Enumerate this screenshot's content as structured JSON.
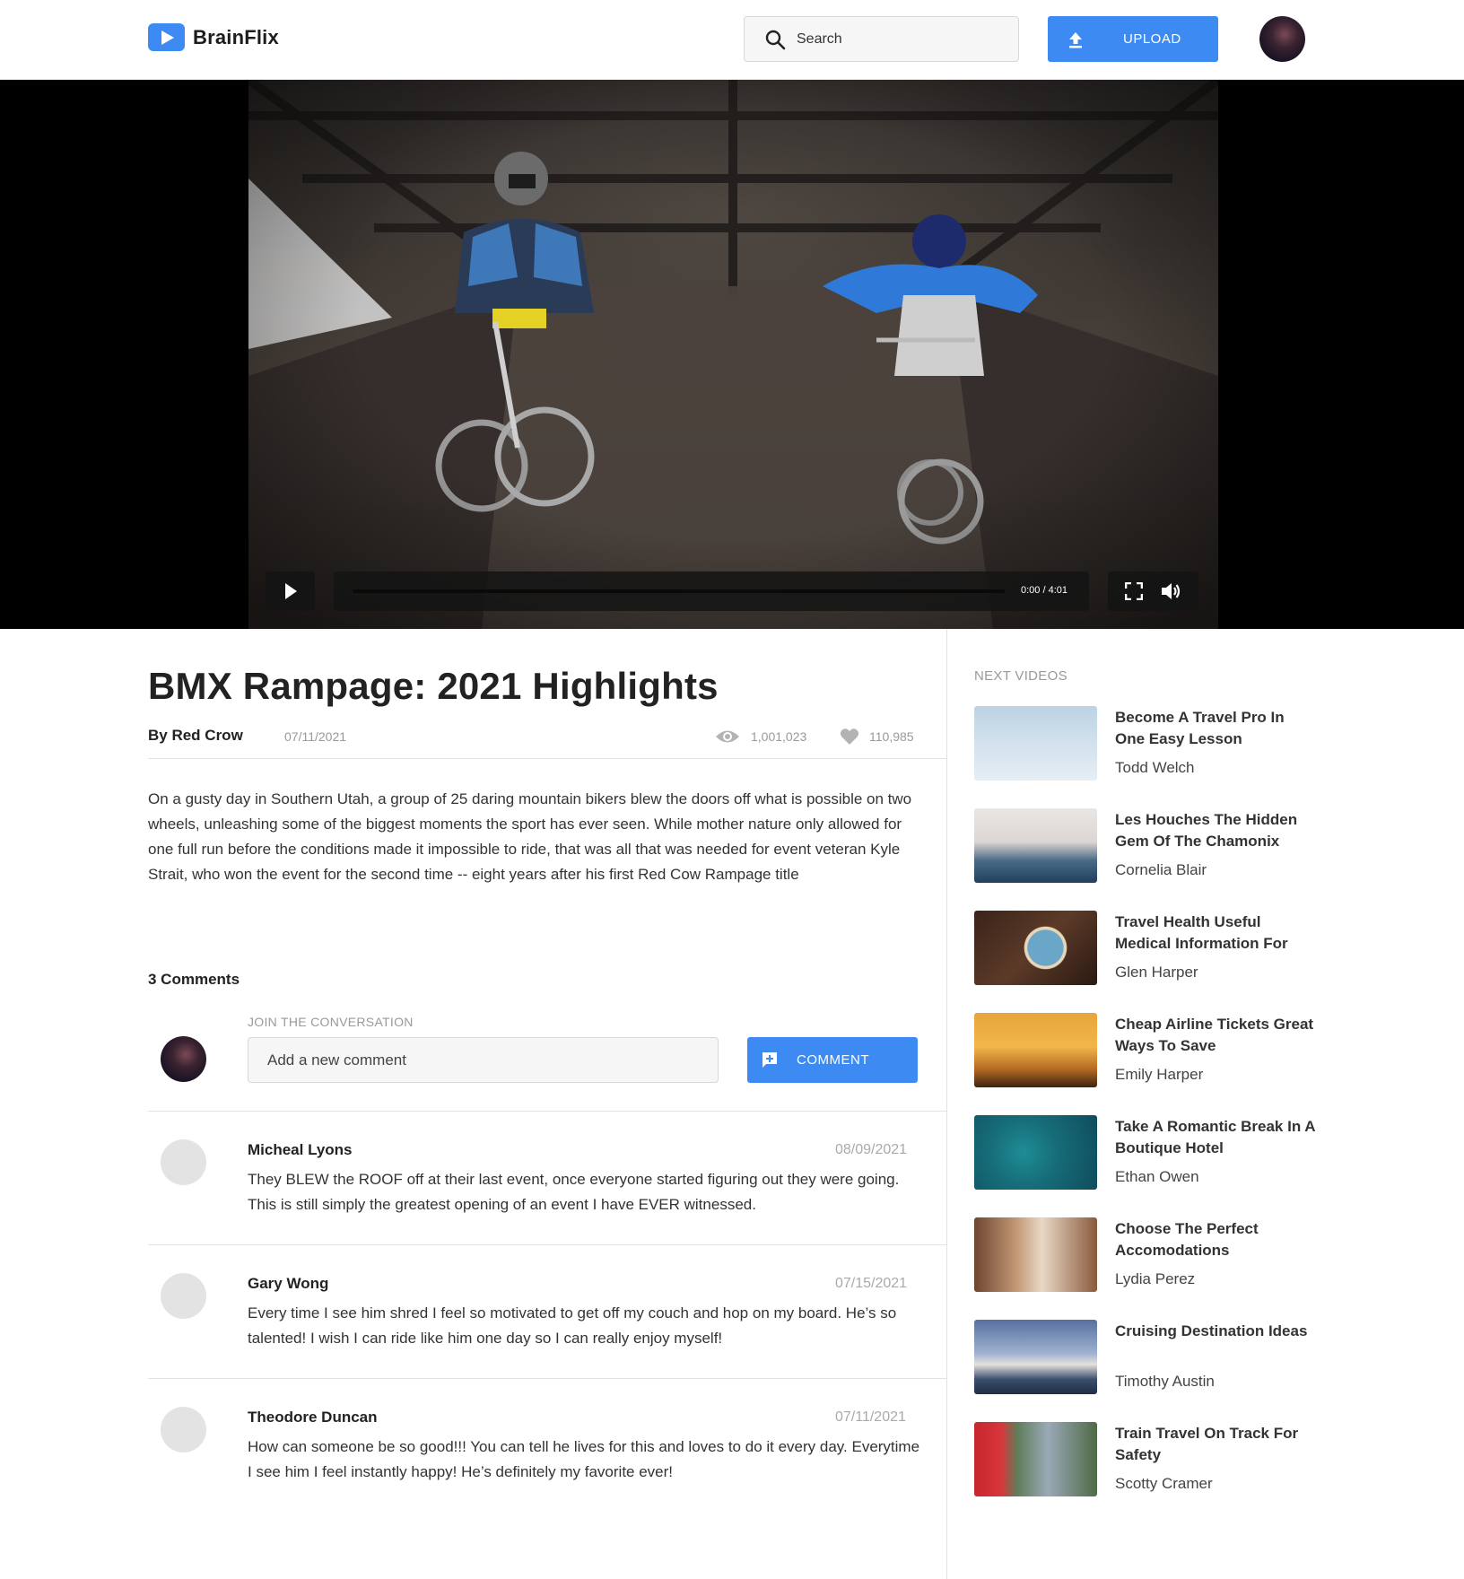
{
  "app": {
    "name": "BrainFlix"
  },
  "header": {
    "search_placeholder": "Search",
    "upload_label": "UPLOAD"
  },
  "player": {
    "time": "0:00 / 4:01",
    "progress": 0
  },
  "video": {
    "title": "BMX Rampage: 2021 Highlights",
    "channel": "By Red Crow",
    "date": "07/11/2021",
    "views": "1,001,023",
    "likes": "110,985",
    "description": "On a gusty day in Southern Utah, a group of 25 daring mountain bikers blew the doors off what is possible on two wheels, unleashing some of the biggest moments the sport has ever seen. While mother nature only allowed for one full run before the conditions made it impossible to ride, that was all that was needed for event veteran Kyle Strait, who won the event for the second time -- eight years after his first Red Cow Rampage title"
  },
  "comments": {
    "count_label": "3 Comments",
    "join_label": "JOIN THE CONVERSATION",
    "input_placeholder": "Add a new comment",
    "button_label": "COMMENT",
    "items": [
      {
        "author": "Micheal Lyons",
        "date": "08/09/2021",
        "text": "They BLEW the ROOF off at their last event, once everyone started figuring out they were going. This is still simply the greatest opening of an event I have EVER witnessed."
      },
      {
        "author": "Gary Wong",
        "date": "07/15/2021",
        "text": "Every time I see him shred I feel so motivated to get off my couch and hop on my board. He’s so talented! I wish I can ride like him one day so I can really enjoy myself!"
      },
      {
        "author": "Theodore Duncan",
        "date": "07/11/2021",
        "text": "How can someone be so good!!! You can tell he lives for this and loves to do it every day. Everytime I see him I feel instantly happy! He’s definitely my favorite ever!"
      }
    ]
  },
  "sidebar": {
    "label": "NEXT VIDEOS",
    "videos": [
      {
        "title": "Become A Travel Pro In One Easy Lesson",
        "author": "Todd Welch"
      },
      {
        "title": "Les Houches The Hidden Gem Of The Chamonix",
        "author": "Cornelia Blair"
      },
      {
        "title": "Travel Health Useful Medical Information For",
        "author": "Glen Harper"
      },
      {
        "title": "Cheap Airline Tickets Great Ways To Save",
        "author": "Emily Harper"
      },
      {
        "title": "Take A Romantic Break In A Boutique Hotel",
        "author": "Ethan Owen"
      },
      {
        "title": "Choose The Perfect Accomodations",
        "author": "Lydia Perez"
      },
      {
        "title": "Cruising Destination Ideas",
        "author": "Timothy Austin"
      },
      {
        "title": "Train Travel On Track For Safety",
        "author": "Scotty Cramer"
      }
    ]
  },
  "colors": {
    "accent": "#3d8bf2",
    "muted": "#999999",
    "divider": "#e2e2e2"
  }
}
